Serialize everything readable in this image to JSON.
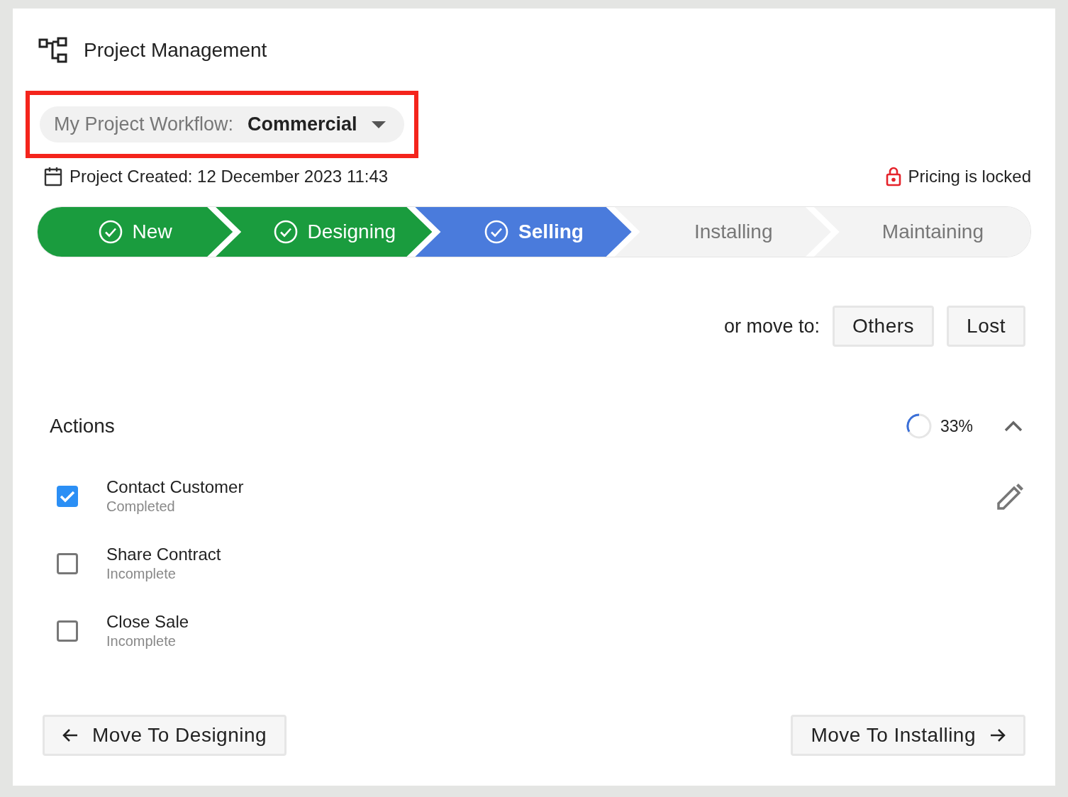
{
  "header": {
    "title": "Project Management"
  },
  "workflow": {
    "label": "My Project Workflow:",
    "value": "Commercial",
    "highlighted": true
  },
  "created": "Project Created: 12 December 2023 11:43",
  "pricing": {
    "text": "Pricing is locked",
    "locked": true
  },
  "stages": [
    {
      "label": "New",
      "completed": true,
      "selected": false
    },
    {
      "label": "Designing",
      "completed": true,
      "selected": false
    },
    {
      "label": "Selling",
      "completed": false,
      "selected": true
    },
    {
      "label": "Installing",
      "completed": false,
      "selected": false
    },
    {
      "label": "Maintaining",
      "completed": false,
      "selected": false
    }
  ],
  "move_to": {
    "label": "or move to:",
    "buttons": [
      "Others",
      "Lost"
    ]
  },
  "actions": {
    "title": "Actions",
    "progress": {
      "level": 0.33,
      "reading": "33%"
    },
    "expanded": true,
    "items": [
      {
        "title": "Contact Customer",
        "status": "Completed",
        "checked": true,
        "editable": true
      },
      {
        "title": "Share Contract",
        "status": "Incomplete",
        "checked": false,
        "editable": false
      },
      {
        "title": "Close Sale",
        "status": "Incomplete",
        "checked": false,
        "editable": false
      }
    ]
  },
  "nav": {
    "back": "Move To Designing",
    "next": "Move To Installing"
  }
}
